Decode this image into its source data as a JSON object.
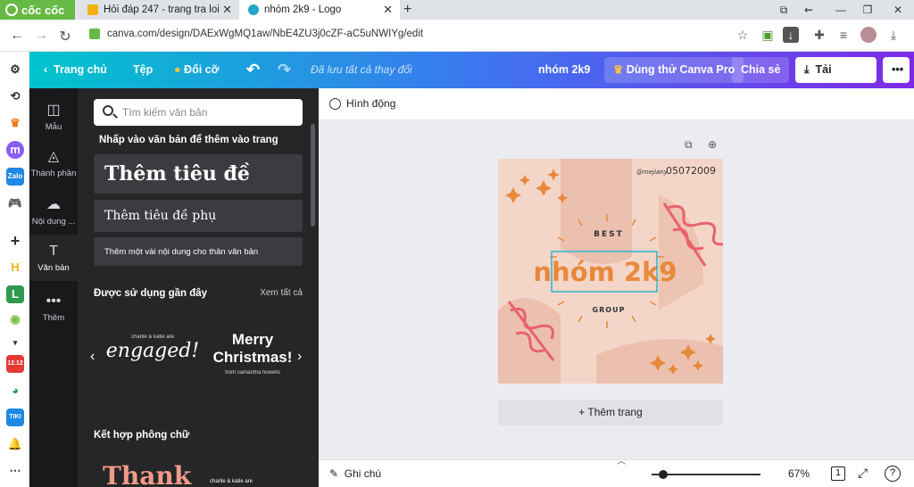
{
  "browser": {
    "brand": "cốc cốc",
    "tabs": [
      {
        "title": "Hỏi đáp 247 - trang tra loi",
        "favicon": "hoidap-icon"
      },
      {
        "title": "nhóm 2k9 - Logo",
        "favicon": "canva-icon",
        "active": true
      }
    ],
    "url": "canva.com/design/DAExWgMQ1aw/NbE4ZU3j0cZF-aC5uNWIYg/edit"
  },
  "canva_header": {
    "home": "Trang chủ",
    "file": "Tệp",
    "resize": "Đổi cỡ",
    "saved": "Đã lưu tất cả thay đổi",
    "design_title": "nhóm 2k9",
    "try_pro": "Dùng thử Canva Pro",
    "share": "Chia sẻ",
    "download": "Tải xuống"
  },
  "rail": [
    {
      "label": "Mẫu",
      "icon": "template-icon"
    },
    {
      "label": "Thành phần",
      "icon": "elements-icon"
    },
    {
      "label": "Nội dung ...",
      "icon": "upload-icon"
    },
    {
      "label": "Văn bản",
      "icon": "text-icon",
      "active": true
    },
    {
      "label": "Thêm",
      "icon": "more-icon"
    }
  ],
  "text_panel": {
    "search_placeholder": "Tìm kiếm văn bản",
    "hint": "Nhấp vào văn bản để thêm vào trang",
    "heading": "Thêm tiêu đề",
    "subheading": "Thêm tiêu đề phụ",
    "body": "Thêm một vài nội dung cho thân văn bản",
    "recent_title": "Được sử dụng gần đây",
    "see_all": "Xem tất cả",
    "samples": [
      {
        "small": "charlie & katie are",
        "big": "engaged!"
      },
      {
        "big": "Merry Christmas!",
        "small": "from samantha howells"
      }
    ],
    "font_combo_title": "Kết hợp phông chữ",
    "combo_preview": "Thank",
    "combo_small": "charlie & katie are"
  },
  "workspace": {
    "animate": "Hình động",
    "add_page": "+ Thêm trang",
    "notes": "Ghi chú",
    "zoom": "67%",
    "page_count": "1"
  },
  "design": {
    "handle": "@mejiany",
    "date": "05072009",
    "top_text": "BEST",
    "main_text": "nhóm 2k9",
    "bottom_text": "GROUP",
    "colors": {
      "background": "#f4d6c9",
      "accent_orange": "#e8883b",
      "accent_pink": "#e8626b",
      "shape": "#e8b6a4"
    }
  }
}
